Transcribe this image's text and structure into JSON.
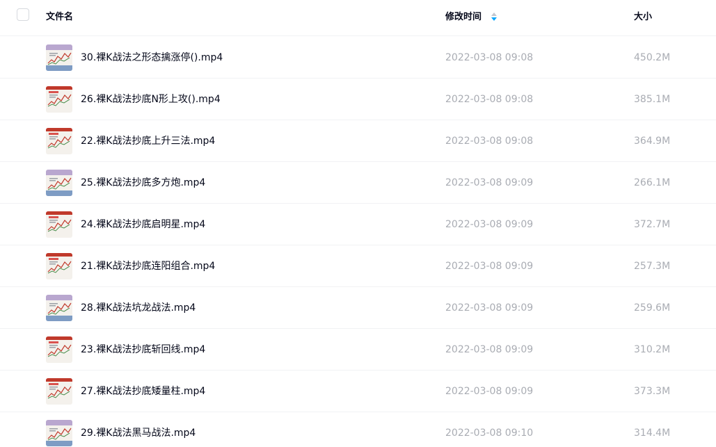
{
  "header": {
    "name_label": "文件名",
    "time_label": "修改时间",
    "size_label": "大小",
    "sort_icon": "sort-icon"
  },
  "colors": {
    "text_primary": "#05081a",
    "text_secondary": "#a9acb3",
    "sort_active": "#06a7ff",
    "divider": "#f1f2f4"
  },
  "files": [
    {
      "name": "30.裸K战法之形态擒涨停().mp4",
      "modified": "2022-03-08 09:08",
      "size": "450.2M",
      "icon": "video-thumbnail-icon"
    },
    {
      "name": "26.裸K战法抄底N形上攻().mp4",
      "modified": "2022-03-08 09:08",
      "size": "385.1M",
      "icon": "video-thumbnail-icon"
    },
    {
      "name": "22.裸K战法抄底上升三法.mp4",
      "modified": "2022-03-08 09:08",
      "size": "364.9M",
      "icon": "video-thumbnail-icon"
    },
    {
      "name": "25.裸K战法抄底多方炮.mp4",
      "modified": "2022-03-08 09:09",
      "size": "266.1M",
      "icon": "video-thumbnail-icon"
    },
    {
      "name": "24.裸K战法抄底启明星.mp4",
      "modified": "2022-03-08 09:09",
      "size": "372.7M",
      "icon": "video-thumbnail-icon"
    },
    {
      "name": "21.裸K战法抄底连阳组合.mp4",
      "modified": "2022-03-08 09:09",
      "size": "257.3M",
      "icon": "video-thumbnail-icon"
    },
    {
      "name": "28.裸K战法坑龙战法.mp4",
      "modified": "2022-03-08 09:09",
      "size": "259.6M",
      "icon": "video-thumbnail-icon"
    },
    {
      "name": "23.裸K战法抄底斩回线.mp4",
      "modified": "2022-03-08 09:09",
      "size": "310.2M",
      "icon": "video-thumbnail-icon"
    },
    {
      "name": "27.裸K战法抄底矮量柱.mp4",
      "modified": "2022-03-08 09:09",
      "size": "373.3M",
      "icon": "video-thumbnail-icon"
    },
    {
      "name": "29.裸K战法黑马战法.mp4",
      "modified": "2022-03-08 09:10",
      "size": "314.4M",
      "icon": "video-thumbnail-icon"
    }
  ]
}
